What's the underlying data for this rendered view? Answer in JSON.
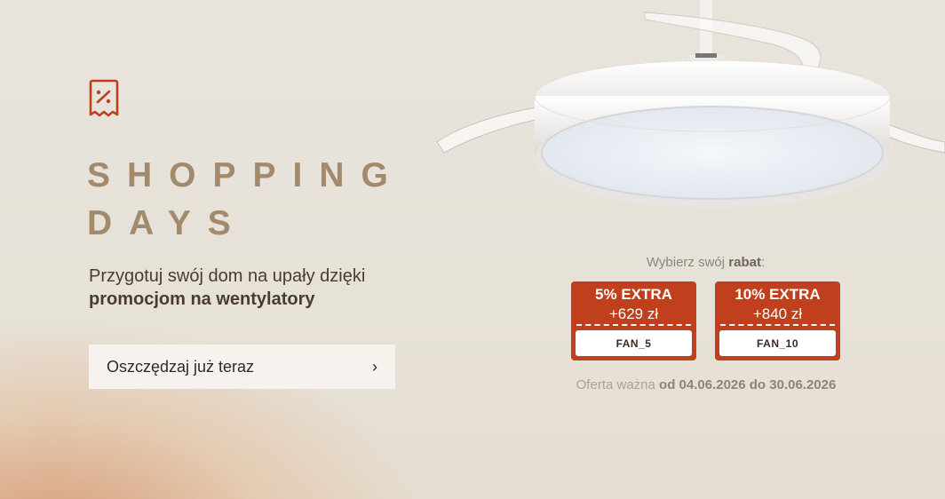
{
  "banner": {
    "title_line1": "SHOPPING",
    "title_line2": "DAYS",
    "subtitle_line1": "Przygotuj swój dom na upały dzięki",
    "subtitle_line2": "promocjom na wentylatory",
    "cta_label": "Oszczędzaj już teraz",
    "cta_chevron": "›"
  },
  "discount": {
    "choose_prefix": "Wybierz swój ",
    "choose_bold": "rabat",
    "choose_suffix": ":",
    "coupons": [
      {
        "title": "5% EXTRA",
        "amount": "+629 zł",
        "code": "FAN_5"
      },
      {
        "title": "10% EXTRA",
        "amount": "+840 zł",
        "code": "FAN_10"
      }
    ],
    "validity_prefix": "Oferta ważna ",
    "validity_bold": "od 04.06.2026 do 30.06.2026"
  },
  "colors": {
    "accent": "#c0401d",
    "title": "#a48a6c",
    "text": "#4a3b32",
    "background": "#e8e4dc"
  },
  "icons": {
    "promo": "receipt-percent-icon",
    "chevron": "chevron-right-icon"
  },
  "image": {
    "alt": "ceiling-fan-with-light"
  }
}
